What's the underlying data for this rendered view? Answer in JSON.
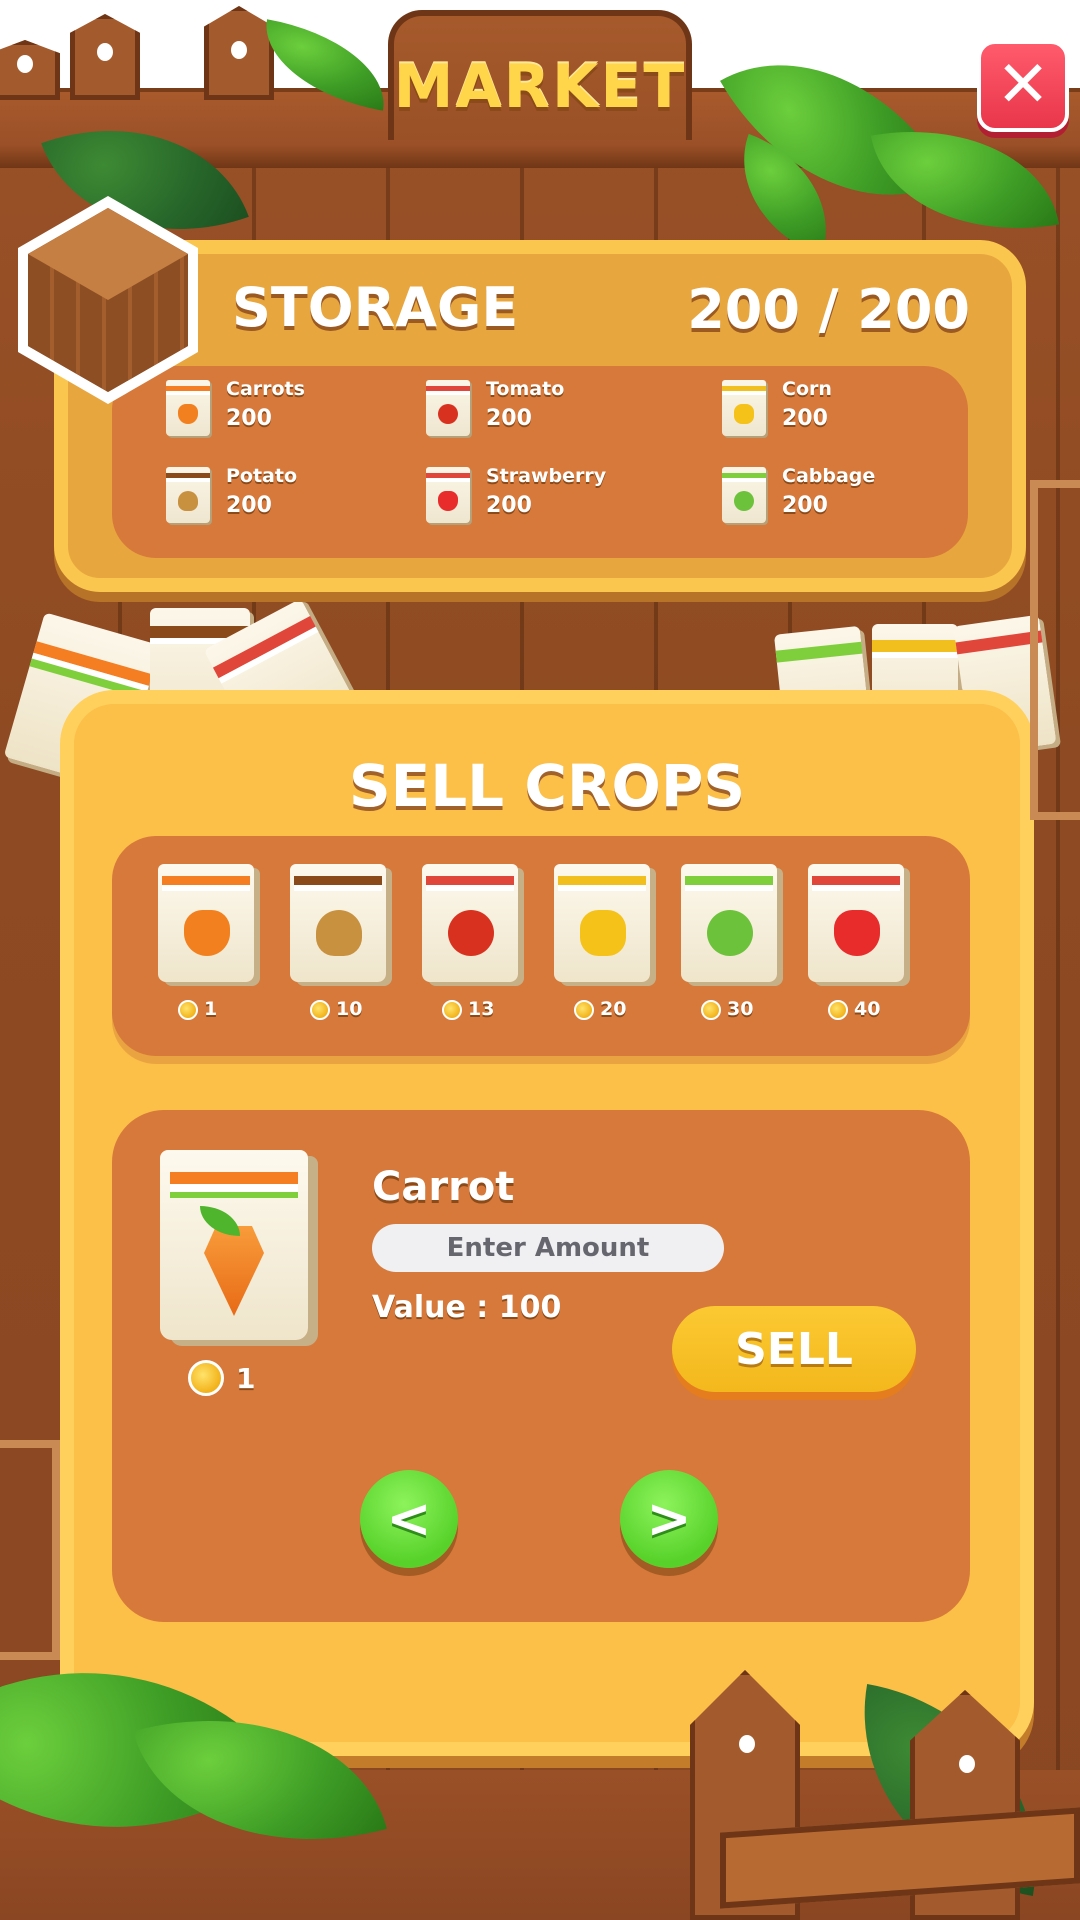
{
  "header": {
    "title": "MARKET",
    "close_label": "✕"
  },
  "storage": {
    "title": "STORAGE",
    "count": "200 / 200",
    "items": [
      {
        "name": "Carrots",
        "qty": "200"
      },
      {
        "name": "Tomato",
        "qty": "200"
      },
      {
        "name": "Corn",
        "qty": "200"
      },
      {
        "name": "Potato",
        "qty": "200"
      },
      {
        "name": "Strawberry",
        "qty": "200"
      },
      {
        "name": "Cabbage",
        "qty": "200"
      }
    ]
  },
  "sell": {
    "title": "SELL CROPS",
    "crops": [
      {
        "icon": "carrot-icon",
        "price": "1"
      },
      {
        "icon": "potato-icon",
        "price": "10"
      },
      {
        "icon": "tomato-icon",
        "price": "13"
      },
      {
        "icon": "corn-icon",
        "price": "20"
      },
      {
        "icon": "cabbage-icon",
        "price": "30"
      },
      {
        "icon": "strawberry-icon",
        "price": "40"
      }
    ],
    "selected": {
      "name": "Carrot",
      "price": "1",
      "amount_placeholder": "Enter Amount",
      "value_text": "Value : 100"
    },
    "sell_label": "SELL",
    "prev_label": "<",
    "next_label": ">"
  },
  "colors": {
    "panel": "#fcbf48",
    "panel_inner": "#d6793a",
    "storage_panel": "#e8a63e",
    "close": "#e9364a",
    "sell_button": "#f3b81c",
    "nav_button": "#57d22a",
    "title_text": "#ffd54a"
  }
}
